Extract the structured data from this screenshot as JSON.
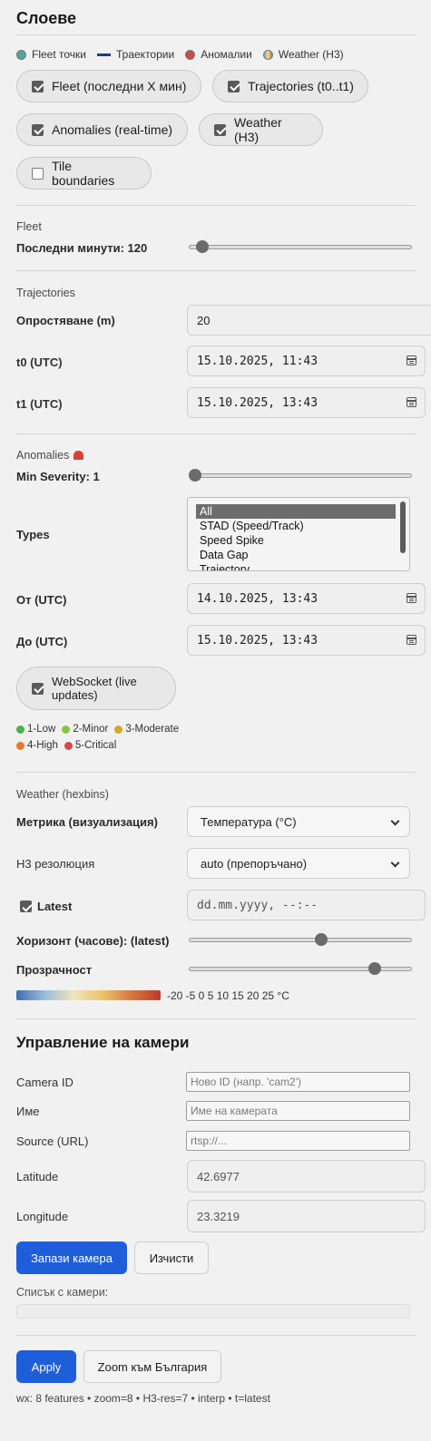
{
  "layers": {
    "title": "Слоеве",
    "legend": [
      {
        "label": "Fleet точки",
        "color": "#4fa89a",
        "icon": "teal-dot-icon"
      },
      {
        "label": "Траектории",
        "color": "#1c3b8c",
        "icon": "line-icon"
      },
      {
        "label": "Аномалии",
        "color": "#d04a4a",
        "icon": "red-dot-icon"
      },
      {
        "label": "Weather (H3)",
        "color": "#e0b84a",
        "icon": "gradient-dot-icon"
      }
    ],
    "toggles": [
      {
        "label": "Fleet (последни X мин)",
        "checked": true
      },
      {
        "label": "Trajectories (t0..t1)",
        "checked": true
      },
      {
        "label": "Anomalies (real-time)",
        "checked": true
      },
      {
        "label": "Weather (H3)",
        "checked": true
      },
      {
        "label": "Tile boundaries",
        "checked": false
      }
    ]
  },
  "fleet": {
    "section": "Fleet",
    "minutes_label": "Последни минути: 120",
    "minutes_value": 120,
    "minutes_fraction": 0.06
  },
  "trajectories": {
    "section": "Trajectories",
    "simplify_label": "Опростяване (m)",
    "simplify_value": "20",
    "t0_label": "t0 (UTC)",
    "t0_value": "15.10.2025, 11:43",
    "t1_label": "t1 (UTC)",
    "t1_value": "15.10.2025, 13:43"
  },
  "anomalies": {
    "section": "Anomalies",
    "section_icon": "siren-icon",
    "severity_label": "Min Severity: 1",
    "severity_fraction": 0.0,
    "types_label": "Types",
    "types": [
      "All",
      "STAD (Speed/Track)",
      "Speed Spike",
      "Data Gap",
      "Trajectory"
    ],
    "types_selected": "All",
    "from_label": "От (UTC)",
    "from_value": "14.10.2025, 13:43",
    "to_label": "До (UTC)",
    "to_value": "15.10.2025, 13:43",
    "websocket_label": "WebSocket (live updates)",
    "websocket_checked": true,
    "severity_legend": [
      {
        "label": "1-Low",
        "color": "#4caf50"
      },
      {
        "label": "2-Minor",
        "color": "#8bc34a"
      },
      {
        "label": "3-Moderate",
        "color": "#d4a72c"
      },
      {
        "label": "4-High",
        "color": "#e07b2a"
      },
      {
        "label": "5-Critical",
        "color": "#d04a4a"
      }
    ]
  },
  "weather": {
    "section": "Weather (hexbins)",
    "metric_label": "Метрика (визуализация)",
    "metric_value": "Температура (°C)",
    "h3_label": "H3 резолюция",
    "h3_value": "auto (препоръчано)",
    "latest_label": "Latest",
    "latest_checked": true,
    "latest_placeholder": "dd.mm.yyyy, --:--",
    "horizon_label": "Хоризонт (часове): (latest)",
    "horizon_fraction": 0.6,
    "opacity_label": "Прозрачност",
    "opacity_fraction": 0.85,
    "scale_text": "-20 -5 0 5 10 15 20 25 °C"
  },
  "cameras": {
    "title": "Управление на камери",
    "camera_id_label": "Camera ID",
    "camera_id_placeholder": "Ново ID (напр. 'cam2')",
    "name_label": "Име",
    "name_placeholder": "Име на камерата",
    "source_label": "Source (URL)",
    "source_placeholder": "rtsp://...",
    "latitude_label": "Latitude",
    "latitude_value": "42.6977",
    "longitude_label": "Longitude",
    "longitude_value": "23.3219",
    "save_label": "Запази камера",
    "clear_label": "Изчисти",
    "list_label": "Списък с камери:"
  },
  "footer": {
    "apply_label": "Apply",
    "zoom_label": "Zoom към България",
    "status": "wx: 8 features • zoom=8 • H3-res=7 • interp • t=latest"
  }
}
